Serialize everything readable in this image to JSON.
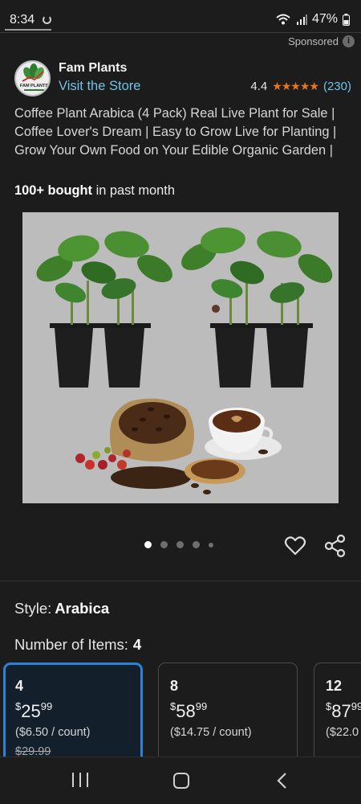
{
  "status_bar": {
    "time": "8:34",
    "battery": "47%"
  },
  "sponsored": {
    "label": "Sponsored"
  },
  "brand": {
    "name": "Fam Plants",
    "store_link": "Visit the Store",
    "logo_text": "FAM PLANTS"
  },
  "rating": {
    "value": "4.4",
    "stars": "★★★★★",
    "stars_value": 4.4,
    "count": "(230)"
  },
  "product": {
    "title": "Coffee Plant Arabica (4 Pack) Real Live Plant for Sale | Coffee Lover's Dream | Easy to Grow Live for Planting | Grow Your Own Food on Your Edible Organic Garden |",
    "bought_bold": "100+ bought",
    "bought_rest": "in past month"
  },
  "gallery": {
    "image_count": 5,
    "active_index": 0
  },
  "style": {
    "label": "Style:",
    "value": "Arabica"
  },
  "items": {
    "label": "Number of Items:",
    "value": "4"
  },
  "options": [
    {
      "qty": "4",
      "currency": "$",
      "whole": "25",
      "fraction": "99",
      "unit_price": "($6.50 / count)",
      "list_price": "$29.99",
      "selected": true
    },
    {
      "qty": "8",
      "currency": "$",
      "whole": "58",
      "fraction": "99",
      "unit_price": "($14.75 / count)",
      "list_price": "",
      "selected": false
    },
    {
      "qty": "12",
      "currency": "$",
      "whole": "87",
      "fraction": "99",
      "unit_price": "($22.0",
      "list_price": "",
      "selected": false
    }
  ],
  "colors": {
    "accent_link": "#6fc3e6",
    "star": "#e7761c",
    "selected_border": "#2a83d6",
    "background": "#1c1c1c"
  }
}
